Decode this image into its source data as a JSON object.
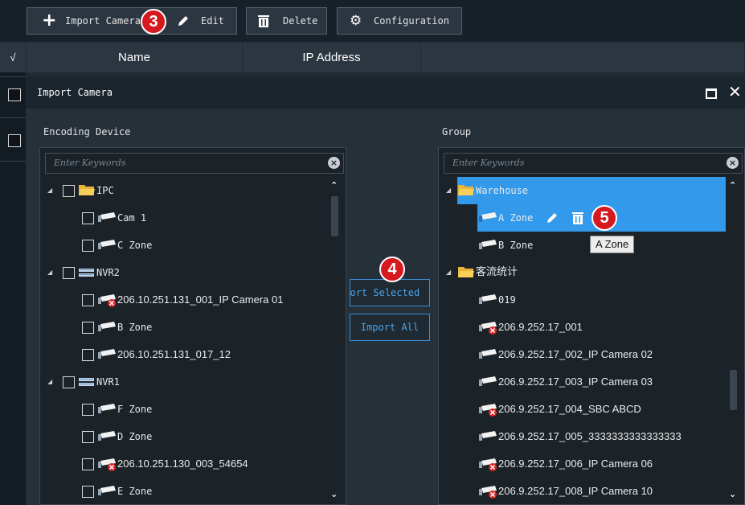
{
  "toolbar": {
    "import_label": "Import Camera",
    "edit_label": "Edit",
    "delete_label": "Delete",
    "configuration_label": "Configuration"
  },
  "grid": {
    "check_header": "√",
    "columns": [
      "Name",
      "IP Address"
    ]
  },
  "dialog": {
    "title": "Import Camera",
    "encoding_label": "Encoding Device",
    "group_label": "Group",
    "search_placeholder": "Enter Keywords",
    "import_selected_label": "Import Selected",
    "import_all_label": "Import All"
  },
  "encoding_tree": [
    {
      "label": "IPC",
      "type": "folder",
      "level": 0
    },
    {
      "label": "Cam 1",
      "type": "camera",
      "level": 1
    },
    {
      "label": "C Zone",
      "type": "camera",
      "level": 1
    },
    {
      "label": "NVR2",
      "type": "nvr",
      "level": 0
    },
    {
      "label": "206.10.251.131_001_IP Camera 01",
      "type": "camera-offline",
      "level": 1
    },
    {
      "label": "B Zone",
      "type": "camera",
      "level": 1
    },
    {
      "label": "206.10.251.131_017_12",
      "type": "camera",
      "level": 1
    },
    {
      "label": "NVR1",
      "type": "nvr",
      "level": 0
    },
    {
      "label": "F Zone",
      "type": "camera",
      "level": 1
    },
    {
      "label": "D Zone",
      "type": "camera",
      "level": 1
    },
    {
      "label": "206.10.251.130_003_54654",
      "type": "camera-offline",
      "level": 1
    },
    {
      "label": "E Zone",
      "type": "camera",
      "level": 1
    }
  ],
  "group_tree": [
    {
      "label": "Warehouse",
      "type": "folder",
      "level": 0,
      "selected": true
    },
    {
      "label": "A Zone",
      "type": "camera",
      "level": 1,
      "selected": true
    },
    {
      "label": "B Zone",
      "type": "camera",
      "level": 1
    },
    {
      "label": "客流统计",
      "type": "folder",
      "level": 0
    },
    {
      "label": "019",
      "type": "camera",
      "level": 1
    },
    {
      "label": "206.9.252.17_001",
      "type": "camera-offline",
      "level": 1
    },
    {
      "label": "206.9.252.17_002_IP Camera 02",
      "type": "camera",
      "level": 1
    },
    {
      "label": "206.9.252.17_003_IP Camera 03",
      "type": "camera",
      "level": 1
    },
    {
      "label": "206.9.252.17_004_SBC ABCD",
      "type": "camera-offline",
      "level": 1
    },
    {
      "label": "206.9.252.17_005_3333333333333333",
      "type": "camera",
      "level": 1
    },
    {
      "label": "206.9.252.17_006_IP Camera 06",
      "type": "camera-offline",
      "level": 1
    },
    {
      "label": "206.9.252.17_008_IP Camera 10",
      "type": "camera-offline",
      "level": 1
    }
  ],
  "tooltip": "A Zone",
  "callouts": {
    "step3": "3",
    "step4": "4",
    "step5": "5"
  },
  "colors": {
    "accent": "#3399ea",
    "callout": "#d6191f"
  },
  "icons": [
    "plus-icon",
    "pencil-icon",
    "trash-icon",
    "gear-icon",
    "folder-icon",
    "camera-icon",
    "nvr-icon",
    "offline-badge-icon",
    "maximize-icon",
    "close-icon"
  ]
}
